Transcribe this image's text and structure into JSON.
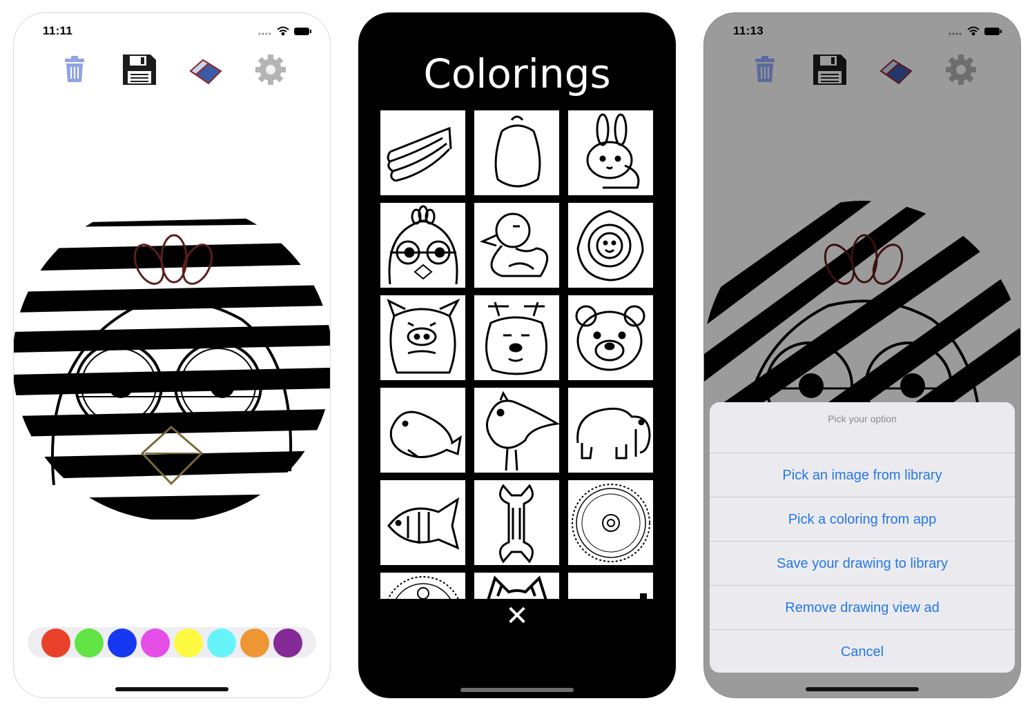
{
  "screens": [
    {
      "status_time": "11:11",
      "toolbar": [
        "trash-icon",
        "floppy-disk-icon",
        "eraser-icon",
        "gear-icon"
      ],
      "palette": [
        "#e8432a",
        "#62e346",
        "#1638f2",
        "#e54fe8",
        "#fdf941",
        "#66f4f8",
        "#ef9634",
        "#842a96"
      ]
    },
    {
      "title": "Colorings",
      "thumbnails": [
        "banana",
        "eggplant",
        "rabbit",
        "chick",
        "duck",
        "lion",
        "pig",
        "deer",
        "bear",
        "seal",
        "bird",
        "elephant",
        "fish",
        "wrench",
        "gear",
        "gear-partial",
        "cat-partial",
        "blank-partial"
      ],
      "close_glyph": "✕"
    },
    {
      "status_time": "11:13",
      "action_sheet": {
        "title": "Pick your option",
        "options": [
          "Pick an image from library",
          "Pick a coloring from app",
          "Save your drawing to library",
          "Remove drawing view ad"
        ],
        "cancel": "Cancel"
      }
    }
  ]
}
